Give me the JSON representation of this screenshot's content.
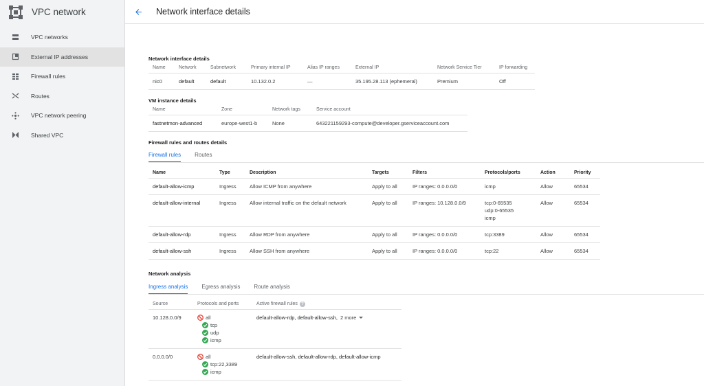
{
  "app": {
    "title": "VPC network",
    "colors": {
      "accent": "#1a73e8",
      "allow": "#34a853",
      "deny": "#ea4335"
    }
  },
  "sidebar": {
    "items": [
      {
        "label": "VPC networks",
        "icon": "vpc-networks-icon"
      },
      {
        "label": "External IP addresses",
        "icon": "external-ip-icon",
        "active": true
      },
      {
        "label": "Firewall rules",
        "icon": "firewall-icon"
      },
      {
        "label": "Routes",
        "icon": "routes-icon"
      },
      {
        "label": "VPC network peering",
        "icon": "peering-icon"
      },
      {
        "label": "Shared VPC",
        "icon": "shared-vpc-icon"
      }
    ]
  },
  "header": {
    "title": "Network interface details"
  },
  "nic": {
    "title": "Network interface details",
    "headers": [
      "Name",
      "Network",
      "Subnetwork",
      "Primary internal IP",
      "Alias IP ranges",
      "External IP",
      "Network Service Tier",
      "IP forwarding"
    ],
    "row": [
      "nic0",
      "default",
      "default",
      "10.132.0.2",
      "—",
      "35.195.28.113 (ephemeral)",
      "Premium",
      "Off"
    ]
  },
  "vm": {
    "title": "VM instance details",
    "headers": [
      "Name",
      "Zone",
      "Network tags",
      "Service account"
    ],
    "row": [
      "fastnetmon-advanced",
      "europe-west1-b",
      "None",
      "643221159293-compute@developer.gserviceaccount.com"
    ]
  },
  "firewall": {
    "title": "Firewall rules and routes details",
    "tabs": [
      "Firewall rules",
      "Routes"
    ],
    "headers": [
      "Name",
      "Type",
      "Description",
      "Targets",
      "Filters",
      "Protocols/ports",
      "Action",
      "Priority"
    ],
    "rows": [
      {
        "name": "default-allow-icmp",
        "type": "Ingress",
        "description": "Allow ICMP from anywhere",
        "targets": "Apply to all",
        "filters": "IP ranges: 0.0.0.0/0",
        "protocols": [
          "icmp"
        ],
        "action": "Allow",
        "priority": "65534"
      },
      {
        "name": "default-allow-internal",
        "type": "Ingress",
        "description": "Allow internal traffic on the default network",
        "targets": "Apply to all",
        "filters": "IP ranges: 10.128.0.0/9",
        "protocols": [
          "tcp:0-65535",
          "udp:0-65535",
          "icmp"
        ],
        "action": "Allow",
        "priority": "65534"
      },
      {
        "name": "default-allow-rdp",
        "type": "Ingress",
        "description": "Allow RDP from anywhere",
        "targets": "Apply to all",
        "filters": "IP ranges: 0.0.0.0/0",
        "protocols": [
          "tcp:3389"
        ],
        "action": "Allow",
        "priority": "65534"
      },
      {
        "name": "default-allow-ssh",
        "type": "Ingress",
        "description": "Allow SSH from anywhere",
        "targets": "Apply to all",
        "filters": "IP ranges: 0.0.0.0/0",
        "protocols": [
          "tcp:22"
        ],
        "action": "Allow",
        "priority": "65534"
      }
    ]
  },
  "analysis": {
    "title": "Network analysis",
    "tabs": [
      "Ingress analysis",
      "Egress analysis",
      "Route analysis"
    ],
    "headers": [
      "Source",
      "Protocols and ports",
      "Active firewall rules"
    ],
    "help_icon": "?",
    "rows": [
      {
        "source": "10.128.0.0/9",
        "protocols": [
          {
            "label": "all",
            "status": "deny"
          },
          {
            "label": "tcp",
            "status": "allow"
          },
          {
            "label": "udp",
            "status": "allow"
          },
          {
            "label": "icmp",
            "status": "allow"
          }
        ],
        "rules": "default-allow-rdp, default-allow-ssh,",
        "more": "2 more"
      },
      {
        "source": "0.0.0.0/0",
        "protocols": [
          {
            "label": "all",
            "status": "deny"
          },
          {
            "label": "tcp:22,3389",
            "status": "allow"
          },
          {
            "label": "icmp",
            "status": "allow"
          }
        ],
        "rules": "default-allow-ssh, default-allow-rdp, default-allow-icmp",
        "more": ""
      }
    ]
  }
}
